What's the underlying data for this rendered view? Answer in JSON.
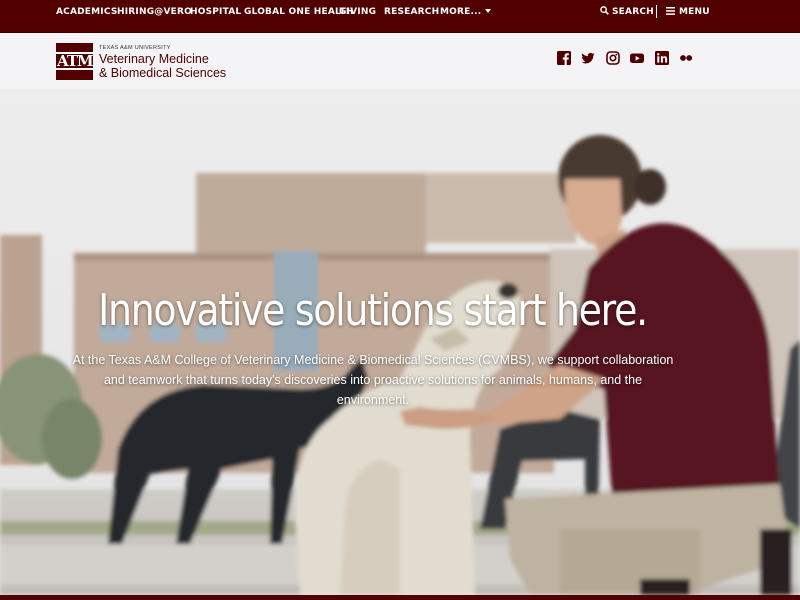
{
  "topnav": {
    "items": [
      "ACADEMICS",
      "HIRING@VERO",
      "HOSPITAL",
      "GLOBAL ONE HEALTH",
      "GIVING",
      "RESEARCH",
      "MORE..."
    ],
    "search_label": "SEARCH",
    "menu_label": "MENU"
  },
  "header": {
    "logo_text": "ATM",
    "university": "TEXAS A&M UNIVERSITY",
    "college_line1": "Veterinary Medicine",
    "college_line2": "& Biomedical Sciences",
    "social_icons": [
      "facebook-icon",
      "twitter-icon",
      "instagram-icon",
      "youtube-icon",
      "linkedin-icon",
      "flickr-icon"
    ]
  },
  "hero": {
    "headline": "Innovative solutions start here.",
    "blurb": "At the Texas A&M College of Veterinary Medicine & Biomedical Sciences (CVMBS), we support collaboration and teamwork that turns today's discoveries into proactive solutions for animals, humans, and the environment."
  },
  "colors": {
    "maroon": "#500000",
    "header_bg": "#f4f4f6"
  }
}
